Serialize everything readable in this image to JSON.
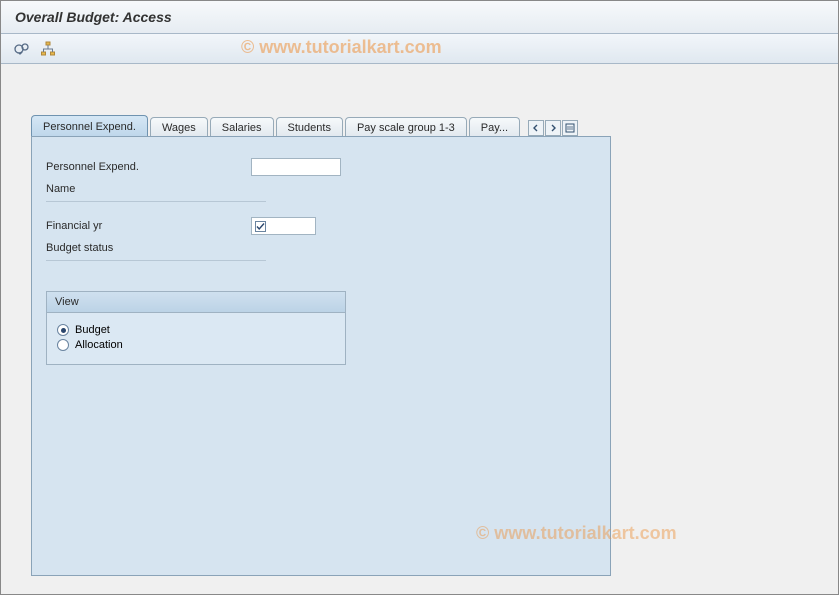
{
  "header": {
    "title": "Overall Budget: Access"
  },
  "watermark": "© www.tutorialkart.com",
  "tabs": [
    {
      "label": "Personnel Expend.",
      "active": true
    },
    {
      "label": "Wages",
      "active": false
    },
    {
      "label": "Salaries",
      "active": false
    },
    {
      "label": "Students",
      "active": false
    },
    {
      "label": "Pay scale group 1-3",
      "active": false
    },
    {
      "label": "Pay...",
      "active": false
    }
  ],
  "form": {
    "personnel_expend_label": "Personnel Expend.",
    "personnel_expend_value": "",
    "name_label": "Name",
    "financial_yr_label": "Financial yr",
    "financial_yr_checked": true,
    "budget_status_label": "Budget status"
  },
  "view_group": {
    "title": "View",
    "options": [
      {
        "label": "Budget",
        "selected": true
      },
      {
        "label": "Allocation",
        "selected": false
      }
    ]
  }
}
